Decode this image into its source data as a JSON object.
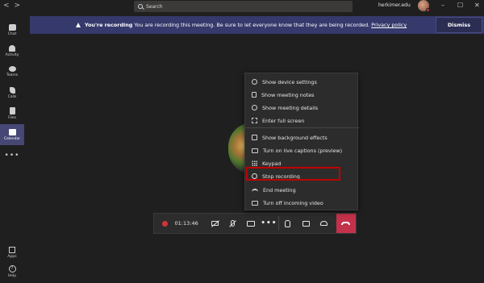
{
  "titlebar": {
    "back": "<",
    "forward": ">",
    "search_placeholder": "Search",
    "org": "herkimer.edu",
    "window_controls": [
      "–",
      "☐",
      "✕"
    ]
  },
  "banner": {
    "title": "You're recording",
    "message": "You are recording this meeting. Be sure to let everyone know that they are being recorded.",
    "link": "Privacy policy",
    "dismiss": "Dismiss"
  },
  "rail": {
    "items": [
      {
        "label": "Chat",
        "icon": "chat-icon"
      },
      {
        "label": "Activity",
        "icon": "bell-icon"
      },
      {
        "label": "Teams",
        "icon": "teams-icon"
      },
      {
        "label": "Calls",
        "icon": "phone-icon"
      },
      {
        "label": "Files",
        "icon": "file-icon"
      },
      {
        "label": "Calendar",
        "icon": "calendar-icon"
      }
    ],
    "more": "•••",
    "apps": "Apps",
    "help": "Help",
    "help_glyph": "?"
  },
  "controls": {
    "timer": "01:13:46",
    "more": "•••"
  },
  "menu": {
    "items": [
      "Show device settings",
      "Show meeting notes",
      "Show meeting details",
      "Enter full screen",
      "Show background effects",
      "Turn on live captions (preview)",
      "Keypad",
      "Stop recording",
      "End meeting",
      "Turn off incoming video"
    ]
  },
  "colors": {
    "banner": "#36396b",
    "rail_active": "#464775",
    "hangup": "#c4314b",
    "highlight": "#c00000"
  }
}
